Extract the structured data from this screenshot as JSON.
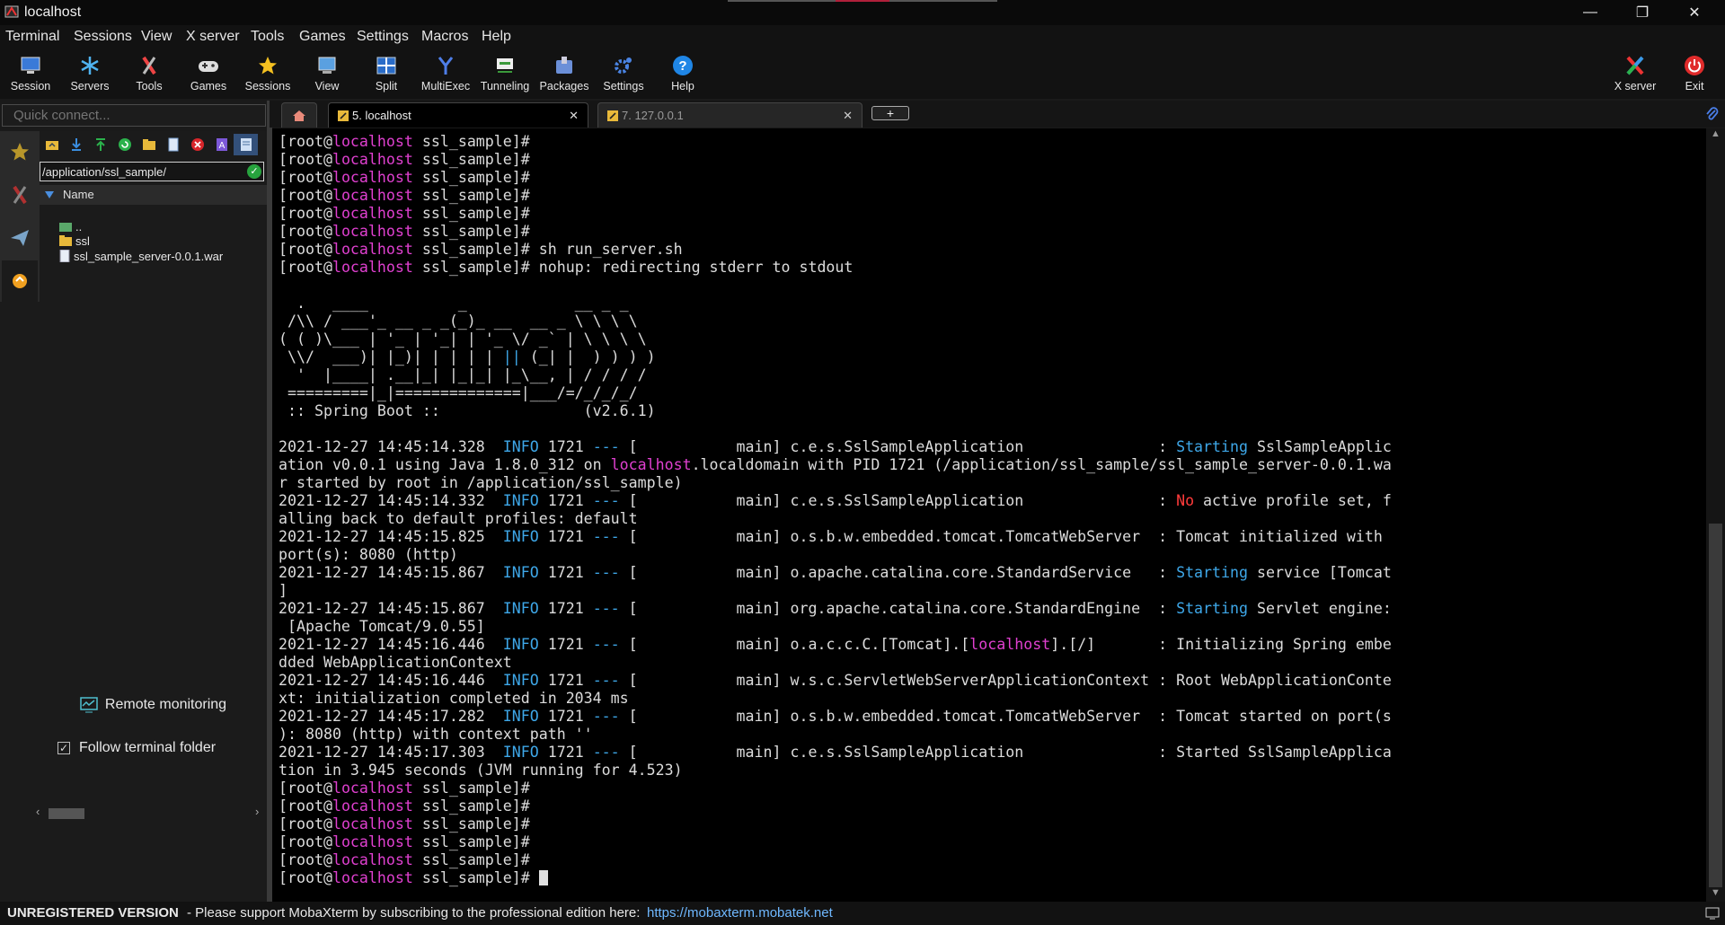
{
  "window": {
    "title": "localhost"
  },
  "menu": [
    "Terminal",
    "Sessions",
    "View",
    "X server",
    "Tools",
    "Games",
    "Settings",
    "Macros",
    "Help"
  ],
  "toolbar": {
    "session": "Session",
    "servers": "Servers",
    "tools": "Tools",
    "games": "Games",
    "sessions": "Sessions",
    "view": "View",
    "split": "Split",
    "multiexec": "MultiExec",
    "tunneling": "Tunneling",
    "packages": "Packages",
    "settings": "Settings",
    "help": "Help",
    "xserver": "X server",
    "exit": "Exit"
  },
  "quick_connect": {
    "placeholder": "Quick connect..."
  },
  "browser": {
    "path": "/application/ssl_sample/",
    "column_name": "Name",
    "files": [
      "..",
      "ssl",
      "ssl_sample_server-0.0.1.war"
    ],
    "remote_monitoring": "Remote monitoring",
    "follow_folder": "Follow terminal folder"
  },
  "tabs": [
    {
      "label": "5. localhost",
      "active": true
    },
    {
      "label": "7. 127.0.0.1",
      "active": false
    }
  ],
  "terminal": {
    "lines": [
      "[root@localhost ssl_sample]#",
      "[root@localhost ssl_sample]#",
      "[root@localhost ssl_sample]#",
      "[root@localhost ssl_sample]#",
      "[root@localhost ssl_sample]#",
      "[root@localhost ssl_sample]#",
      "[root@localhost ssl_sample]# sh run_server.sh",
      "[root@localhost ssl_sample]# nohup: redirecting stderr to stdout",
      "",
      "  .   ____          _            __ _ _",
      " /\\\\ / ___'_ __ _ _(_)_ __  __ _ \\ \\ \\ \\",
      "( ( )\\___ | '_ | '_| | '_ \\/ _` | \\ \\ \\ \\",
      " \\\\/  ___)| |_)| | | | | || (_| |  ) ) ) )",
      "  '  |____| .__|_| |_|_| |_\\__, | / / / /",
      " =========|_|==============|___/=/_/_/_/",
      " :: Spring Boot ::                (v2.6.1)",
      "",
      "2021-12-27 14:45:14.328  INFO 1721 --- [           main] c.e.s.SslSampleApplication               : Starting SslSampleApplic",
      "ation v0.0.1 using Java 1.8.0_312 on localhost.localdomain with PID 1721 (/application/ssl_sample/ssl_sample_server-0.0.1.wa",
      "r started by root in /application/ssl_sample)",
      "2021-12-27 14:45:14.332  INFO 1721 --- [           main] c.e.s.SslSampleApplication               : No active profile set, f",
      "alling back to default profiles: default",
      "2021-12-27 14:45:15.825  INFO 1721 --- [           main] o.s.b.w.embedded.tomcat.TomcatWebServer  : Tomcat initialized with",
      "port(s): 8080 (http)",
      "2021-12-27 14:45:15.867  INFO 1721 --- [           main] o.apache.catalina.core.StandardService   : Starting service [Tomcat",
      "]",
      "2021-12-27 14:45:15.867  INFO 1721 --- [           main] org.apache.catalina.core.StandardEngine  : Starting Servlet engine:",
      " [Apache Tomcat/9.0.55]",
      "2021-12-27 14:45:16.446  INFO 1721 --- [           main] o.a.c.c.C.[Tomcat].[localhost].[/]       : Initializing Spring embe",
      "dded WebApplicationContext",
      "2021-12-27 14:45:16.446  INFO 1721 --- [           main] w.s.c.ServletWebServerApplicationContext : Root WebApplicationConte",
      "xt: initialization completed in 2034 ms",
      "2021-12-27 14:45:17.282  INFO 1721 --- [           main] o.s.b.w.embedded.tomcat.TomcatWebServer  : Tomcat started on port(s",
      "): 8080 (http) with context path ''",
      "2021-12-27 14:45:17.303  INFO 1721 --- [           main] c.e.s.SslSampleApplication               : Started SslSampleApplica",
      "tion in 3.945 seconds (JVM running for 4.523)",
      "[root@localhost ssl_sample]#",
      "[root@localhost ssl_sample]#",
      "[root@localhost ssl_sample]#",
      "[root@localhost ssl_sample]#",
      "[root@localhost ssl_sample]#",
      "[root@localhost ssl_sample]# "
    ]
  },
  "statusbar": {
    "unregistered": "UNREGISTERED VERSION",
    "message": "-  Please support MobaXterm by subscribing to the professional edition here:",
    "link": "https://mobaxterm.mobatek.net"
  },
  "colors": {
    "host": "#e040d0",
    "info": "#3ea7e8",
    "warn": "#ff3b3b"
  }
}
